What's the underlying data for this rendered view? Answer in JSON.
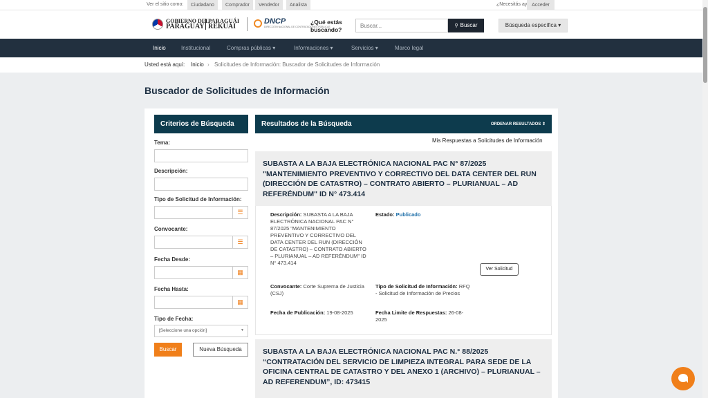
{
  "topbar": {
    "view_label": "Ver el sitio como:",
    "roles": [
      "Ciudadano",
      "Comprador",
      "Vendedor",
      "Analista"
    ],
    "help": "¿Necesitás ayuda?",
    "login": "Acceder"
  },
  "header": {
    "gov_line1": "GOBIERNO DEL",
    "gov_line2": "PARAGUAY",
    "gov_line3": "PARAGUÁI",
    "gov_line4": "REKUÁI",
    "dncp_name": "DNCP",
    "dncp_sub": "DIRECCIÓN NACIONAL DE CONTRATACIONES PÚBLICAS",
    "question": "¿Qué estás buscando?",
    "search_placeholder": "Buscar...",
    "search_button": "Buscar",
    "specific_search": "Búsqueda específica"
  },
  "nav": {
    "items": [
      "Inicio",
      "Institucional",
      "Compras públicas",
      "Informaciones",
      "Servicios",
      "Marco legal"
    ],
    "dropdown_caret": "▾"
  },
  "breadcrumb": {
    "prefix": "Usted está aquí:",
    "items": [
      "Inicio",
      "Solicitudes de Información: Buscador de Solicitudes de Información"
    ],
    "separator": "›"
  },
  "page_title": "Buscador de Solicitudes de Información",
  "criteria": {
    "heading": "Criterios de Búsqueda",
    "tema": "Tema:",
    "descripcion": "Descripción:",
    "tipo_solicitud": "Tipo de Solicitud de Información:",
    "convocante": "Convocante:",
    "fecha_desde": "Fecha Desde:",
    "fecha_hasta": "Fecha Hasta:",
    "tipo_fecha": "Tipo de Fecha:",
    "tipo_fecha_value": "[Seleccione una opción]",
    "buscar": "Buscar",
    "nueva": "Nueva Búsqueda"
  },
  "results": {
    "heading": "Resultados de la Búsqueda",
    "order": "ORDENAR RESULTADOS",
    "my_responses": "Mis Respuestas a Solicitudes de Información",
    "items": [
      {
        "title": "SUBASTA A LA BAJA ELECTRÓNICA NACIONAL PAC N° 87/2025 \"MANTENIMIENTO PREVENTIVO Y CORRECTIVO DEL DATA CENTER DEL RUN (DIRECCIÓN DE CATASTRO) – CONTRATO ABIERTO – PLURIANUAL – AD REFERÉNDUM\" ID N° 473.414",
        "desc_label": "Descripción:",
        "desc_value": "SUBASTA A LA BAJA ELECTRÓNICA NACIONAL PAC N° 87/2025 \"MANTENIMIENTO PREVENTIVO Y CORRECTIVO DEL DATA CENTER DEL RUN (DIRECCIÓN DE CATASTRO) – CONTRATO ABIERTO – PLURIANUAL – AD REFERÉNDUM\" ID N° 473.414",
        "estado_label": "Estado:",
        "estado_value": "Publicado",
        "conv_label": "Convocante:",
        "conv_value": "Corte Suprema de Justicia (CSJ)",
        "tipo_label": "Tipo de Solicitud de Información:",
        "tipo_value": "RFQ - Solicitud de Información de Precios",
        "pub_label": "Fecha de Publicación:",
        "pub_value": "19-08-2025",
        "limite_label": "Fecha Limite de Respuestas:",
        "limite_value": "26-08-2025",
        "button": "Ver Solicitud"
      },
      {
        "title": "SUBASTA A LA BAJA ELECTRÓNICA NACIONAL PAC N.° 88/2025 “CONTRATACIÓN DEL SERVICIO DE LIMPIEZA INTEGRAL PARA SEDE DE LA OFICINA CENTRAL DE CATASTRO Y DEL ANEXO 1 (ARCHIVO) – PLURIANUAL – AD REFERENDUM”, ID: 473415"
      }
    ]
  },
  "colors": {
    "nav_bg": "#22303f",
    "panel_head": "#0d3b4d",
    "accent": "#f07f1a",
    "link": "#1d6ea8"
  },
  "icons": {
    "calendar": "📅",
    "list": "☰",
    "search": "🔍",
    "sort": "⇕",
    "chat": "chat-bubble-icon"
  }
}
